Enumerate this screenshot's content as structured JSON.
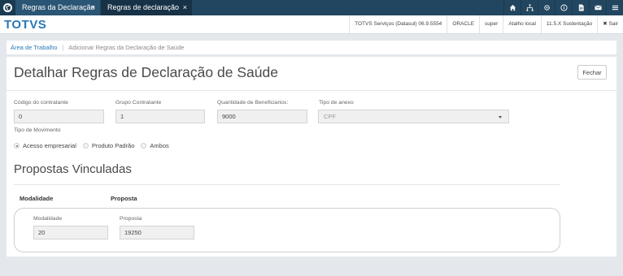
{
  "tabs": [
    {
      "label": "Regras da Declaração",
      "close": "×"
    },
    {
      "label": "Regras de declaração",
      "close": "×"
    }
  ],
  "top_icons": [
    "home-icon",
    "sitemap-icon",
    "gear-icon",
    "help-icon",
    "document-icon",
    "mail-icon",
    "menu-icon"
  ],
  "brand": "TOTVS",
  "status": {
    "server": "TOTVS Serviços (Datasul) 06.9.5554",
    "db": "ORACLE",
    "user": "super",
    "shortcut": "Atalho local",
    "version": "11.5.X Sustentação",
    "logout": "✖ Sair"
  },
  "breadcrumb": {
    "home": "Área de Trabalho",
    "current": "Adicionar Regras da Declaração de Saúde"
  },
  "page": {
    "title": "Detalhar Regras de Declaração de Saúde",
    "close_label": "Fechar"
  },
  "fields": {
    "codigo_label": "Código do contratante",
    "codigo_value": "0",
    "grupo_label": "Grupo Contratante",
    "grupo_value": "1",
    "qtd_label": "Quantidade de Beneficiarios:",
    "qtd_value": "9000",
    "anexo_label": "Tipo de anexo",
    "anexo_value": "CPF",
    "movimento_label": "Tipo de Movimento"
  },
  "movimento_options": [
    {
      "label": "Acesso empresarial",
      "selected": true
    },
    {
      "label": "Produto Padrão",
      "selected": false
    },
    {
      "label": "Ambos",
      "selected": false
    }
  ],
  "section": {
    "title": "Propostas Vinculadas",
    "col_modalidade": "Modalidade",
    "col_proposta": "Proposta"
  },
  "row": {
    "modalidade_label": "Modalidade",
    "modalidade_value": "20",
    "proposta_label": "Proposta",
    "proposta_value": "19250"
  }
}
